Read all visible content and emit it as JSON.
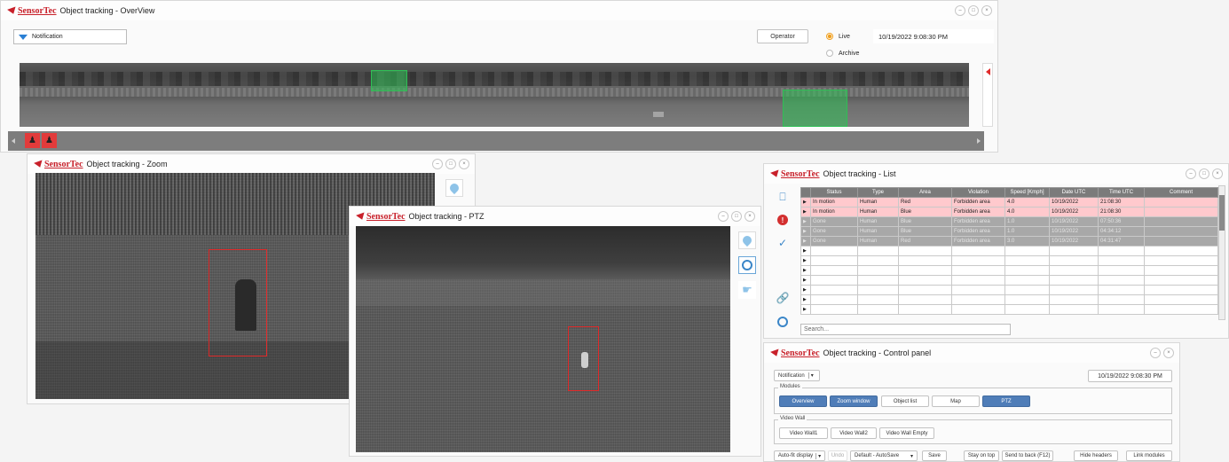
{
  "brand": "SensorTec",
  "overview": {
    "title": "Object tracking - OverView",
    "notification_label": "Notification",
    "operator_label": "Operator",
    "live_label": "Live",
    "archive_label": "Archive",
    "datetime": "10/19/2022 9:08:30 PM",
    "alert_count": 2
  },
  "zoom": {
    "title": "Object tracking - Zoom"
  },
  "ptz": {
    "title": "Object tracking - PTZ"
  },
  "list": {
    "title": "Object tracking - List",
    "columns": [
      "Status",
      "Type",
      "Area",
      "Violation",
      "Speed [Kmph]",
      "Date UTC",
      "Time UTC",
      "Comment"
    ],
    "rows": [
      {
        "state": "red",
        "cells": [
          "In motion",
          "Human",
          "Red",
          "Forbidden area",
          "4.0",
          "10/19/2022",
          "21:08:30",
          ""
        ]
      },
      {
        "state": "red",
        "cells": [
          "In motion",
          "Human",
          "Blue",
          "Forbidden area",
          "4.0",
          "10/19/2022",
          "21:08:30",
          ""
        ]
      },
      {
        "state": "gray",
        "cells": [
          "Gone",
          "Human",
          "Blue",
          "Forbidden area",
          "1.0",
          "10/19/2022",
          "07:50:36",
          ""
        ]
      },
      {
        "state": "gray",
        "cells": [
          "Gone",
          "Human",
          "Blue",
          "Forbidden area",
          "1.0",
          "10/19/2022",
          "04:34:12",
          ""
        ]
      },
      {
        "state": "gray",
        "cells": [
          "Gone",
          "Human",
          "Red",
          "Forbidden area",
          "3.0",
          "10/19/2022",
          "04:31:47",
          ""
        ]
      }
    ],
    "empty_rows": 7,
    "search_placeholder": "Search..."
  },
  "control": {
    "title": "Object tracking - Control panel",
    "notification_label": "Notification",
    "datetime": "10/19/2022 9:08:30 PM",
    "modules_label": "Modules",
    "modules": [
      {
        "label": "Overview",
        "active": true
      },
      {
        "label": "Zoom window",
        "active": true
      },
      {
        "label": "Object list",
        "active": false
      },
      {
        "label": "Map",
        "active": false
      },
      {
        "label": "PTZ",
        "active": true
      }
    ],
    "videowall_label": "Video Wall",
    "videowalls": [
      "Video Wall1",
      "Video Wall2",
      "Video Wall Empty"
    ],
    "autofit_label": "Auto-fit display",
    "undo_label": "Undo",
    "layout_value": "Default - AutoSave",
    "save_label": "Save",
    "stay_on_top_label": "Stay on top",
    "send_back_label": "Send to back (F12)",
    "hide_headers_label": "Hide headers",
    "link_modules_label": "Link modules"
  },
  "colors": {
    "brand": "#c8202a",
    "accent": "#4f7db8",
    "alert": "#e23b3b",
    "detect_green": "#2fbf55",
    "detect_red": "#e02b2b"
  }
}
